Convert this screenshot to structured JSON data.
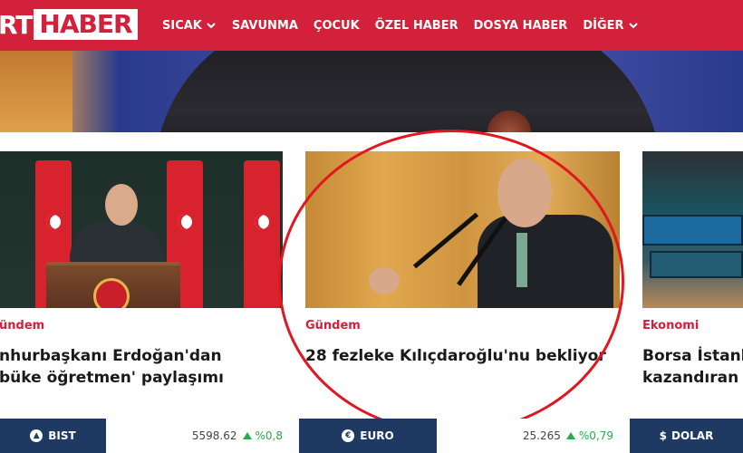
{
  "header": {
    "logo_prefix": "RT",
    "logo_main": "HABER",
    "nav": [
      {
        "label": "SICAK",
        "dropdown": true
      },
      {
        "label": "SAVUNMA",
        "dropdown": false
      },
      {
        "label": "ÇOCUK",
        "dropdown": false
      },
      {
        "label": "ÖZEL HABER",
        "dropdown": false
      },
      {
        "label": "DOSYA HABER",
        "dropdown": false
      },
      {
        "label": "DİĞER",
        "dropdown": true
      }
    ]
  },
  "cards": [
    {
      "category": "ündem",
      "title_line1": "nhurbaşkanı Erdoğan'dan",
      "title_line2": "büke öğretmen' paylaşımı"
    },
    {
      "category": "Gündem",
      "title_line1": "28 fezleke Kılıçdaroğlu'nu bekliyor",
      "title_line2": ""
    },
    {
      "category": "Ekonomi",
      "title_line1": "Borsa İstanb",
      "title_line2": "kazandıran h"
    }
  ],
  "ticker": [
    {
      "label": "BIST",
      "icon": "chart-icon",
      "value": "5598.62",
      "change": "%0,8",
      "trend": "up"
    },
    {
      "label": "EURO",
      "icon": "euro-icon",
      "value": "25.265",
      "change": "%0,79",
      "trend": "up"
    },
    {
      "label": "DOLAR",
      "icon": "dollar-icon",
      "value": "",
      "change": "",
      "trend": ""
    }
  ],
  "colors": {
    "brand_red": "#d3203b",
    "ticker_blue": "#1f3a62",
    "trend_green": "#2ea84a",
    "annotation_red": "#e2161f"
  }
}
